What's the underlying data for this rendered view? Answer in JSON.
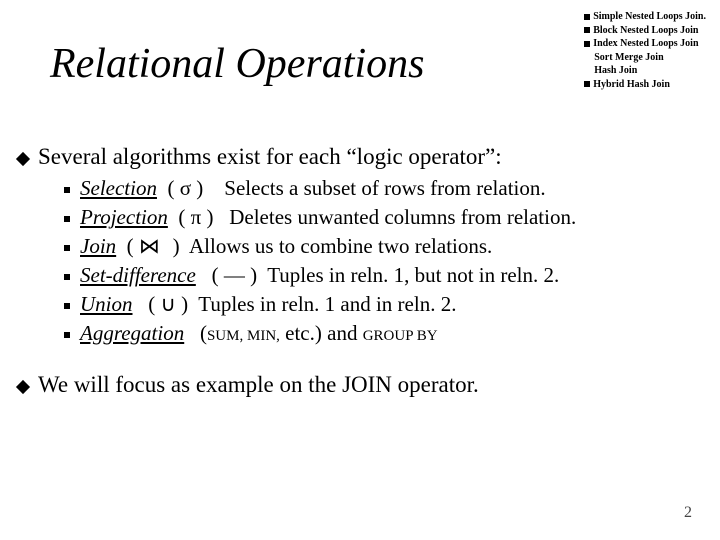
{
  "sidebar": {
    "items": [
      {
        "label": "Simple Nested Loops Join.",
        "shape": "sq"
      },
      {
        "label": "Block Nested Loops Join",
        "shape": "sq"
      },
      {
        "label": "Index Nested Loops Join",
        "shape": "sq"
      },
      {
        "label": "Sort Merge Join",
        "shape": "dia"
      },
      {
        "label": "Hash Join",
        "shape": "dia"
      },
      {
        "label": "Hybrid Hash Join",
        "shape": "sq"
      }
    ]
  },
  "title": "Relational Operations",
  "bullets": {
    "intro": "Several algorithms exist for each “logic operator”:",
    "items": [
      {
        "op": "Selection",
        "symtxt": "σ",
        "desc": "Selects a subset of rows from relation."
      },
      {
        "op": "Projection",
        "symtxt": "π",
        "desc": "Deletes unwanted columns from relation."
      },
      {
        "op": "Join",
        "symtxt": "⋈",
        "desc": "Allows us to combine two relations."
      },
      {
        "op": "Set-difference",
        "symtxt": "—",
        "desc": "Tuples in reln. 1, but not in reln. 2."
      },
      {
        "op": "Union",
        "symtxt": "∪",
        "desc": "Tuples in reln. 1 and in reln. 2."
      },
      {
        "op": "Aggregation",
        "symtxt": "",
        "desc_prefix": "SUM, MIN,",
        "desc_suffix": " etc.) and ",
        "desc_tail": "GROUP BY"
      }
    ],
    "closing": "We will focus as example on the JOIN operator."
  },
  "page": "2",
  "paren_open": "(",
  "paren_close": ")",
  "space": " "
}
